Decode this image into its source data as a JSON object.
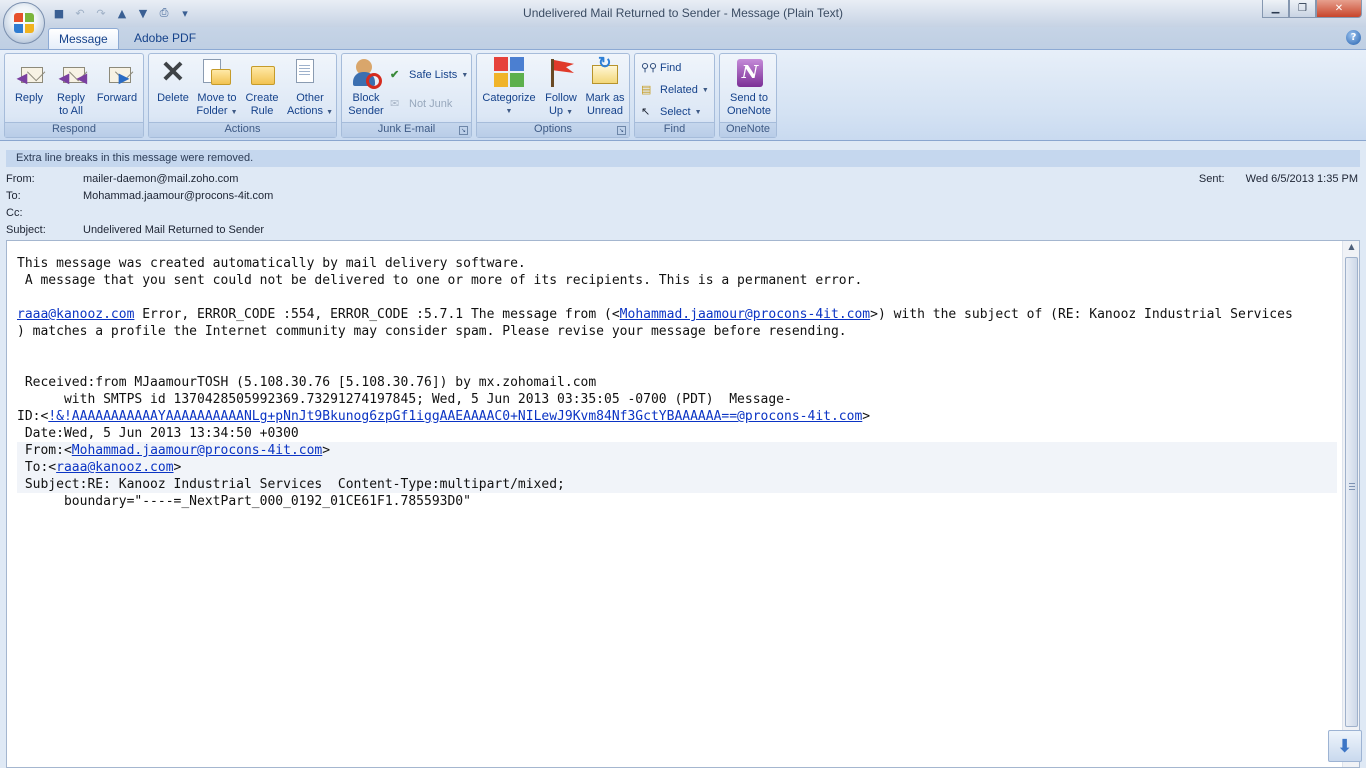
{
  "window": {
    "title": "Undelivered Mail Returned to Sender - Message (Plain Text)",
    "controls": [
      "minimize",
      "maximize",
      "close"
    ]
  },
  "quick_access": [
    {
      "name": "save-icon",
      "glyph": "💾"
    },
    {
      "name": "undo-icon",
      "glyph": "↶"
    },
    {
      "name": "redo-icon",
      "glyph": "↷"
    },
    {
      "name": "up-arrow-icon",
      "glyph": "⇧"
    },
    {
      "name": "down-arrow-icon",
      "glyph": "⇩"
    },
    {
      "name": "print-preview-icon",
      "glyph": "⎙"
    },
    {
      "name": "customize-icon",
      "glyph": "▾"
    }
  ],
  "tabs": {
    "message": "Message",
    "adobe_pdf": "Adobe PDF"
  },
  "ribbon": {
    "respond": {
      "label": "Respond",
      "reply": "Reply",
      "reply_all_1": "Reply",
      "reply_all_2": "to All",
      "forward": "Forward"
    },
    "actions": {
      "label": "Actions",
      "delete": "Delete",
      "move_1": "Move to",
      "move_2": "Folder",
      "create_1": "Create",
      "create_2": "Rule",
      "other_1": "Other",
      "other_2": "Actions"
    },
    "junk": {
      "label": "Junk E-mail",
      "block_1": "Block",
      "block_2": "Sender",
      "safe_lists": "Safe Lists",
      "not_junk": "Not Junk"
    },
    "options": {
      "label": "Options",
      "categorize": "Categorize",
      "follow_1": "Follow",
      "follow_2": "Up",
      "mark_1": "Mark as",
      "mark_2": "Unread"
    },
    "find": {
      "label": "Find",
      "find": "Find",
      "related": "Related",
      "select": "Select"
    },
    "onenote": {
      "label": "OneNote",
      "send_1": "Send to",
      "send_2": "OneNote"
    }
  },
  "infobar": "Extra line breaks in this message were removed.",
  "headers": {
    "from_label": "From:",
    "from": "mailer-daemon@mail.zoho.com",
    "to_label": "To:",
    "to": "Mohammad.jaamour@procons-4it.com",
    "cc_label": "Cc:",
    "cc": "",
    "subject_label": "Subject:",
    "subject": "Undelivered Mail Returned to Sender",
    "sent_label": "Sent:",
    "sent": "Wed 6/5/2013 1:35 PM"
  },
  "body": {
    "l1": "This message was created automatically by mail delivery software.",
    "l2": " A message that you sent could not be delivered to one or more of its recipients. This is a permanent error.",
    "l4_link": "raaa@kanooz.com",
    "l4_a": " Error, ERROR_CODE :554, ERROR_CODE :5.7.1 The message from (<",
    "l4_link2": "Mohammad.jaamour@procons-4it.com",
    "l4_b": ">) with the subject of (RE: Kanooz Industrial Services",
    "l5": ") matches a profile the Internet community may consider spam. Please revise your message before resending.",
    "l8": " Received:from MJaamourTOSH (5.108.30.76 [5.108.30.76]) by mx.zohomail.com",
    "l9": "      with SMTPS id 1370428505992369.73291274197845; Wed, 5 Jun 2013 03:35:05 -0700 (PDT)  Message-",
    "l10_a": "ID:<",
    "l10_link": "!&!AAAAAAAAAAAYAAAAAAAAAANLg+pNnJt9Bkunog6zpGf1iggAAEAAAAC0+NILewJ9Kvm84Nf3GctYBAAAAAA==@procons-4it.com",
    "l10_b": ">",
    "l11": " Date:Wed, 5 Jun 2013 13:34:50 +0300",
    "l12_a": " From:<",
    "l12_link": "Mohammad.jaamour@procons-4it.com",
    "l12_b": ">",
    "l13_a": " To:<",
    "l13_link": "raaa@kanooz.com",
    "l13_b": ">",
    "l14": " Subject:RE: Kanooz Industrial Services  Content-Type:multipart/mixed;",
    "l15": "      boundary=\"----=_NextPart_000_0192_01CE61F1.785593D0\""
  },
  "colors": {
    "link": "#0b34c4",
    "ribbon_text": "#15428b",
    "infobar": "#c5d7ee"
  }
}
